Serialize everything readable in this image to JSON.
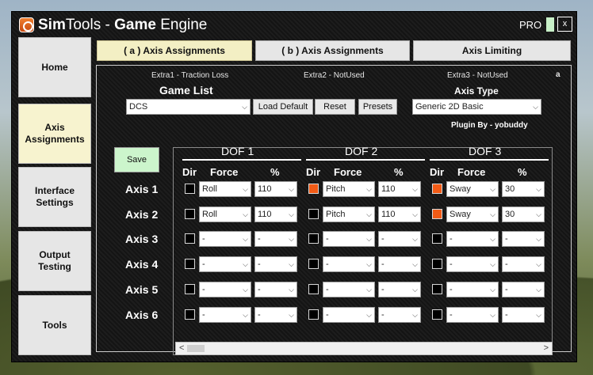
{
  "window": {
    "title_prefix": "Sim",
    "title_mid": "Tools - ",
    "title_bold": "Game",
    "title_suffix": " Engine",
    "pro": "PRO",
    "close": "x"
  },
  "sidebar": {
    "items": [
      {
        "label": "Home",
        "active": false
      },
      {
        "label": "Axis\nAssignments",
        "active": true
      },
      {
        "label": "Interface\nSettings",
        "active": false
      },
      {
        "label": "Output\nTesting",
        "active": false
      },
      {
        "label": "Tools",
        "active": false
      }
    ]
  },
  "tabs": [
    {
      "label": "( a ) Axis Assignments",
      "active": true
    },
    {
      "label": "( b ) Axis Assignments",
      "active": false
    },
    {
      "label": "Axis Limiting",
      "active": false
    }
  ],
  "extras": {
    "e1": "Extra1 - Traction Loss",
    "e2": "Extra2 - NotUsed",
    "e3": "Extra3 - NotUsed",
    "corner": "a"
  },
  "game": {
    "heading": "Game List",
    "selected": "DCS",
    "load_default": "Load Default",
    "reset": "Reset",
    "presets": "Presets"
  },
  "axis_type": {
    "heading": "Axis Type",
    "selected": "Generic 2D Basic",
    "plugin_by": "Plugin By - yobuddy"
  },
  "save_label": "Save",
  "dof_headers": [
    "DOF 1",
    "DOF 2",
    "DOF 3"
  ],
  "col_headers": {
    "dir": "Dir",
    "force": "Force",
    "pct": "%"
  },
  "axes": [
    {
      "label": "Axis 1",
      "dof": [
        {
          "dir": false,
          "force": "Roll",
          "pct": "110"
        },
        {
          "dir": true,
          "force": "Pitch",
          "pct": "110"
        },
        {
          "dir": true,
          "force": "Sway",
          "pct": "30"
        }
      ]
    },
    {
      "label": "Axis 2",
      "dof": [
        {
          "dir": false,
          "force": "Roll",
          "pct": "110"
        },
        {
          "dir": false,
          "force": "Pitch",
          "pct": "110"
        },
        {
          "dir": true,
          "force": "Sway",
          "pct": "30"
        }
      ]
    },
    {
      "label": "Axis 3",
      "dof": [
        {
          "dir": false,
          "force": "-",
          "pct": "-"
        },
        {
          "dir": false,
          "force": "-",
          "pct": "-"
        },
        {
          "dir": false,
          "force": "-",
          "pct": "-"
        }
      ]
    },
    {
      "label": "Axis 4",
      "dof": [
        {
          "dir": false,
          "force": "-",
          "pct": "-"
        },
        {
          "dir": false,
          "force": "-",
          "pct": "-"
        },
        {
          "dir": false,
          "force": "-",
          "pct": "-"
        }
      ]
    },
    {
      "label": "Axis 5",
      "dof": [
        {
          "dir": false,
          "force": "-",
          "pct": "-"
        },
        {
          "dir": false,
          "force": "-",
          "pct": "-"
        },
        {
          "dir": false,
          "force": "-",
          "pct": "-"
        }
      ]
    },
    {
      "label": "Axis 6",
      "dof": [
        {
          "dir": false,
          "force": "-",
          "pct": "-"
        },
        {
          "dir": false,
          "force": "-",
          "pct": "-"
        },
        {
          "dir": false,
          "force": "-",
          "pct": "-"
        }
      ]
    }
  ],
  "colors": {
    "accent_checkbox": "#f25b16",
    "save_bg": "#ccf5cc",
    "active_tab": "#f3efc4"
  }
}
